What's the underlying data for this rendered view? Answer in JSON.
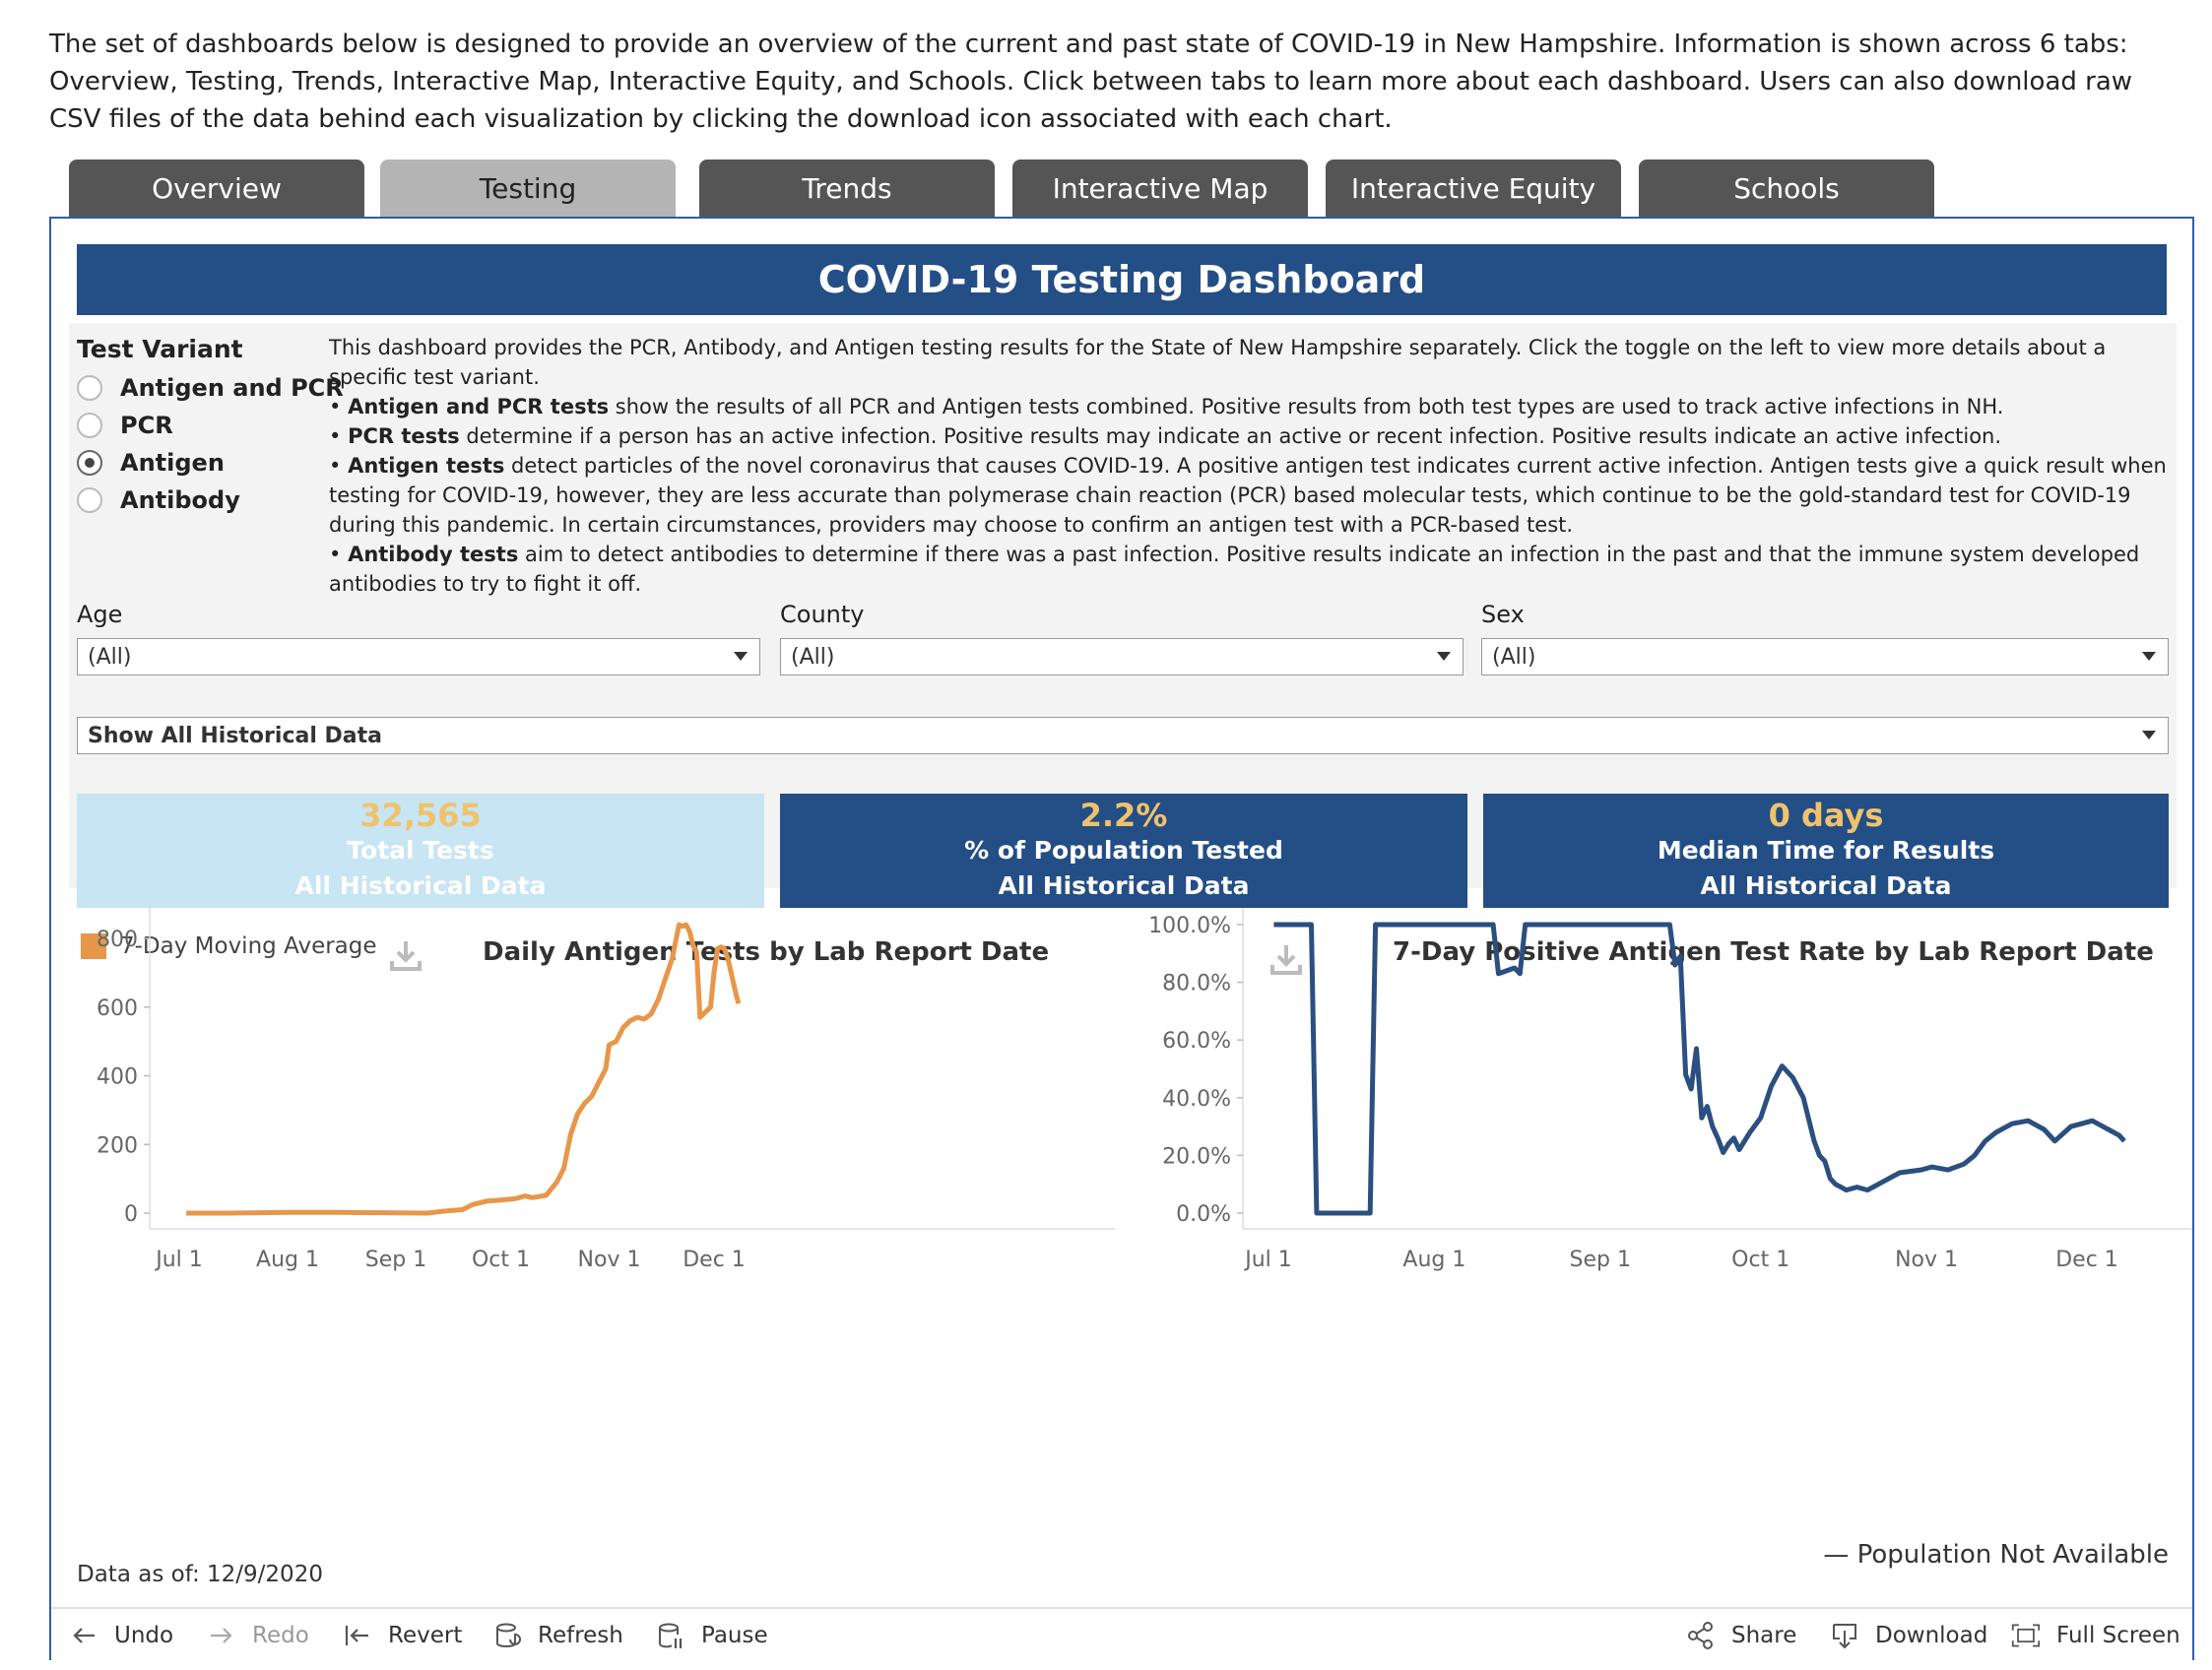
{
  "intro": "The set of dashboards below is designed to provide an overview of the current and past state of COVID-19 in New Hampshire. Information is shown across 6 tabs: Overview, Testing, Trends, Interactive Map, Interactive Equity, and Schools. Click between tabs to learn more about each dashboard. Users can also download raw CSV files of the data behind each visualization by clicking the download icon associated with each chart.",
  "tabs": [
    {
      "label": "Overview"
    },
    {
      "label": "Testing"
    },
    {
      "label": "Trends"
    },
    {
      "label": "Interactive Map"
    },
    {
      "label": "Interactive Equity"
    },
    {
      "label": "Schools"
    }
  ],
  "active_tab": "Testing",
  "banner": "COVID-19 Testing Dashboard",
  "test_variant": {
    "title": "Test Variant",
    "options": [
      "Antigen and PCR",
      "PCR",
      "Antigen",
      "Antibody"
    ],
    "selected": "Antigen"
  },
  "description": {
    "intro": "This dashboard provides the PCR, Antibody, and Antigen testing results for the State of New Hampshire separately. Click the toggle on the left to view more details about a specific test variant.",
    "items": [
      {
        "bold": "Antigen and PCR tests",
        "text": " show the results of all PCR and Antigen tests combined. Positive results from both test types are used to track active infections in NH."
      },
      {
        "bold": "PCR tests",
        "text": " determine if a person has an active infection. Positive results may indicate an active or recent infection. Positive results indicate an active infection."
      },
      {
        "bold": "Antigen tests",
        "text": " detect particles of the novel coronavirus that causes COVID-19. A positive antigen test indicates current active infection.  Antigen tests give a quick result when testing for COVID-19, however, they are less accurate than polymerase chain reaction (PCR) based molecular tests, which continue to be the gold-standard test for COVID-19 during this pandemic. In certain circumstances, providers may choose to confirm an antigen test with a PCR-based test."
      },
      {
        "bold": "Antibody tests",
        "text": " aim to detect antibodies to determine if there was a past infection. Positive results indicate an infection in the past and that the immune system developed antibodies to try to fight it off."
      }
    ]
  },
  "filters": {
    "age": {
      "label": "Age",
      "value": "(All)"
    },
    "county": {
      "label": "County",
      "value": "(All)"
    },
    "sex": {
      "label": "Sex",
      "value": "(All)"
    },
    "history": {
      "value": "Show All Historical Data"
    }
  },
  "kpis": [
    {
      "value": "32,565",
      "line1": "Total Tests",
      "line2": "All Historical Data"
    },
    {
      "value": "2.2%",
      "line1": "% of Population Tested",
      "line2": "All Historical Data"
    },
    {
      "value": "0 days",
      "line1": "Median Time for Results",
      "line2": "All Historical Data"
    }
  ],
  "colors": {
    "accent": "#234e86",
    "orange": "#e8964a",
    "navy_line": "#2a4f80",
    "kpi_light": "#c7e5f2",
    "kpi_value": "#f0c36b",
    "tab": "#555555",
    "tab_active": "#b4b4b4"
  },
  "legend": {
    "label": "7-Day Moving Average"
  },
  "chart_data": [
    {
      "type": "line",
      "title": "Daily Antigen Tests by Lab Report Date",
      "xlabel": "",
      "ylabel": "",
      "x_ticks": [
        "Jul 1",
        "Aug 1",
        "Sep 1",
        "Oct 1",
        "Nov 1",
        "Dec 1"
      ],
      "y_ticks": [
        "0",
        "200",
        "400",
        "600",
        "800"
      ],
      "ylim": [
        0,
        900
      ],
      "series": [
        {
          "name": "7-Day Moving Average",
          "x": [
            "2020-07-03",
            "2020-07-15",
            "2020-08-01",
            "2020-08-15",
            "2020-09-01",
            "2020-09-10",
            "2020-09-14",
            "2020-09-20",
            "2020-09-23",
            "2020-09-27",
            "2020-10-01",
            "2020-10-05",
            "2020-10-08",
            "2020-10-10",
            "2020-10-14",
            "2020-10-17",
            "2020-10-19",
            "2020-10-21",
            "2020-10-23",
            "2020-10-25",
            "2020-10-27",
            "2020-10-31",
            "2020-11-01",
            "2020-11-03",
            "2020-11-05",
            "2020-11-07",
            "2020-11-09",
            "2020-11-11",
            "2020-11-13",
            "2020-11-15",
            "2020-11-17",
            "2020-11-19",
            "2020-11-21",
            "2020-11-22",
            "2020-11-23",
            "2020-11-24",
            "2020-11-25",
            "2020-11-26",
            "2020-11-27",
            "2020-11-28",
            "2020-11-30",
            "2020-12-01",
            "2020-12-02",
            "2020-12-03",
            "2020-12-04",
            "2020-12-05",
            "2020-12-07",
            "2020-12-08"
          ],
          "values": [
            0,
            0,
            2,
            2,
            1,
            0,
            5,
            10,
            25,
            35,
            38,
            42,
            50,
            45,
            52,
            90,
            130,
            230,
            290,
            320,
            340,
            420,
            490,
            500,
            540,
            560,
            570,
            565,
            580,
            620,
            680,
            740,
            840,
            835,
            840,
            820,
            780,
            760,
            570,
            580,
            600,
            700,
            770,
            775,
            770,
            740,
            650,
            610
          ]
        }
      ]
    },
    {
      "type": "line",
      "title": "7-Day Positive Antigen Test Rate by Lab Report Date",
      "xlabel": "",
      "ylabel": "",
      "x_ticks": [
        "Jul 1",
        "Aug 1",
        "Sep 1",
        "Oct 1",
        "Nov 1",
        "Dec 1"
      ],
      "y_ticks": [
        "0.0%",
        "20.0%",
        "40.0%",
        "60.0%",
        "80.0%",
        "100.0%"
      ],
      "ylim": [
        0,
        100
      ],
      "series": [
        {
          "name": "",
          "x": [
            "2020-07-02",
            "2020-07-09",
            "2020-07-10",
            "2020-07-20",
            "2020-07-21",
            "2020-08-12",
            "2020-08-13",
            "2020-08-16",
            "2020-08-17",
            "2020-08-18",
            "2020-08-19",
            "2020-09-14",
            "2020-09-15",
            "2020-09-16",
            "2020-09-17",
            "2020-09-18",
            "2020-09-19",
            "2020-09-20",
            "2020-09-21",
            "2020-09-22",
            "2020-09-23",
            "2020-09-24",
            "2020-09-25",
            "2020-09-26",
            "2020-09-27",
            "2020-09-29",
            "2020-10-01",
            "2020-10-03",
            "2020-10-05",
            "2020-10-07",
            "2020-10-09",
            "2020-10-11",
            "2020-10-12",
            "2020-10-13",
            "2020-10-14",
            "2020-10-15",
            "2020-10-16",
            "2020-10-17",
            "2020-10-19",
            "2020-10-21",
            "2020-10-23",
            "2020-10-25",
            "2020-10-27",
            "2020-10-31",
            "2020-11-02",
            "2020-11-05",
            "2020-11-08",
            "2020-11-10",
            "2020-11-12",
            "2020-11-14",
            "2020-11-17",
            "2020-11-20",
            "2020-11-23",
            "2020-11-25",
            "2020-11-28",
            "2020-11-30",
            "2020-12-02",
            "2020-12-04",
            "2020-12-05",
            "2020-12-07",
            "2020-12-08"
          ],
          "values": [
            100,
            100,
            0,
            0,
            100,
            100,
            83,
            85,
            83,
            100,
            100,
            100,
            86,
            89,
            48,
            43,
            57,
            33,
            37,
            30,
            26,
            21,
            24,
            26,
            22,
            28,
            33,
            44,
            51,
            47,
            40,
            25,
            20,
            18,
            12,
            10,
            9,
            8,
            9,
            8,
            10,
            12,
            14,
            15,
            16,
            15,
            17,
            20,
            25,
            28,
            31,
            32,
            29,
            25,
            30,
            31,
            32,
            30,
            29,
            27,
            25
          ]
        }
      ]
    }
  ],
  "as_of": "Data as of: 12/9/2020",
  "population_note": "— Population Not Available",
  "toolbar": {
    "undo": "Undo",
    "redo": "Redo",
    "revert": "Revert",
    "refresh": "Refresh",
    "pause": "Pause",
    "share": "Share",
    "download": "Download",
    "fullscreen": "Full Screen"
  }
}
